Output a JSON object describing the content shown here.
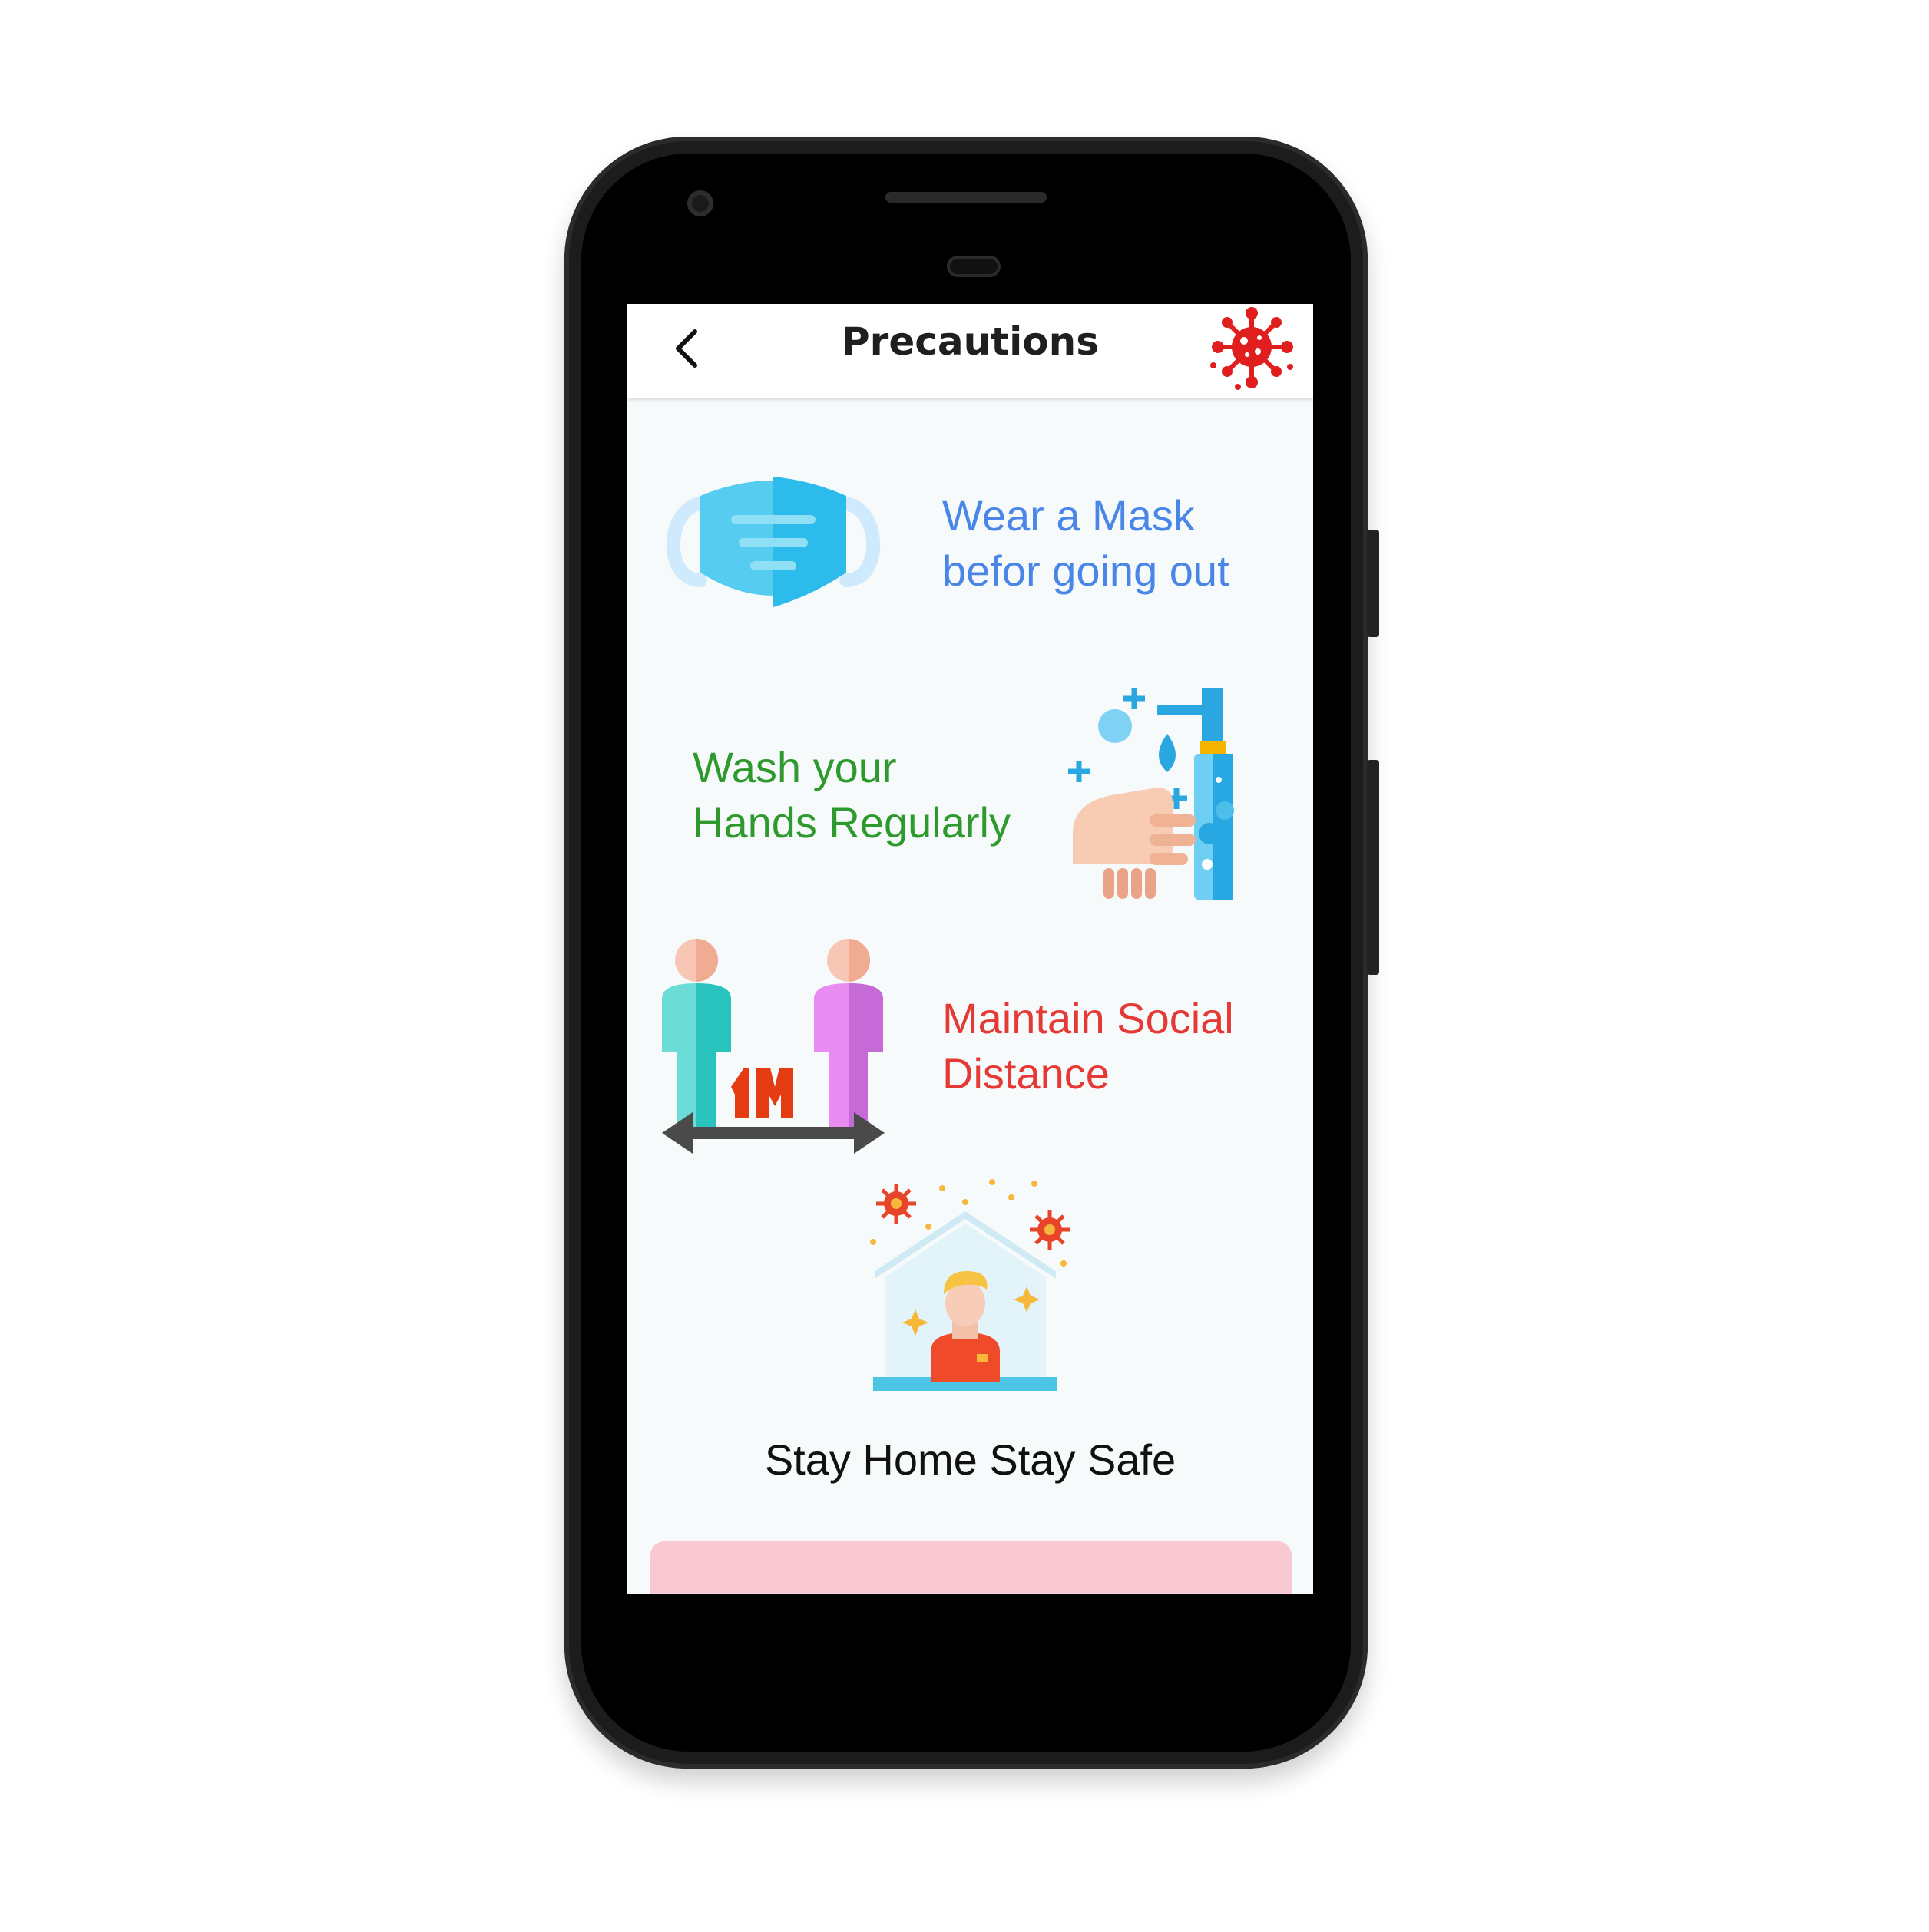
{
  "app": {
    "title": "Precautions",
    "back_icon": "back-arrow-icon",
    "logo_icon": "virus-icon",
    "logo_color": "#e01e1e"
  },
  "precautions": [
    {
      "text_line1": "Wear a Mask",
      "text_line2": "befor going out",
      "color": "#4a86e8",
      "icon": "face-mask-icon"
    },
    {
      "text_line1": "Wash your",
      "text_line2": "Hands Regularly",
      "color": "#2e9a2e",
      "icon": "hand-wash-icon"
    },
    {
      "text_line1": "Maintain Social",
      "text_line2": "Distance",
      "color": "#e53935",
      "icon": "social-distance-icon",
      "distance_label": "1M"
    },
    {
      "text_line1": "Stay Home Stay Safe",
      "color": "#111111",
      "icon": "stay-home-icon"
    }
  ],
  "footer_card_color": "#f8c9d2"
}
